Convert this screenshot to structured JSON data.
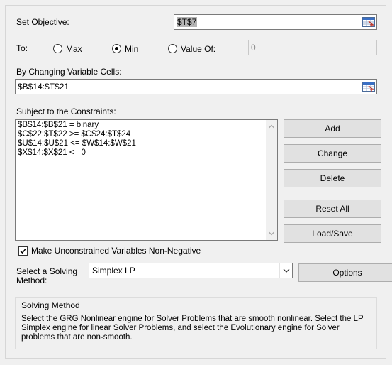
{
  "objective": {
    "label": "Set Objective:",
    "value": "$T$7"
  },
  "to": {
    "label": "To:",
    "options": [
      {
        "label": "Max",
        "checked": false
      },
      {
        "label": "Min",
        "checked": true
      },
      {
        "label": "Value Of:",
        "checked": false
      }
    ],
    "value_of": "0"
  },
  "changing_cells": {
    "label": "By Changing Variable Cells:",
    "value": "$B$14:$T$21"
  },
  "constraints": {
    "label": "Subject to the Constraints:",
    "items": [
      "$B$14:$B$21 = binary",
      "$C$22:$T$22 >= $C$24:$T$24",
      "$U$14:$U$21 <= $W$14:$W$21",
      "$X$14:$X$21 <= 0"
    ]
  },
  "buttons": {
    "add": "Add",
    "change": "Change",
    "delete": "Delete",
    "reset_all": "Reset All",
    "load_save": "Load/Save",
    "options": "Options"
  },
  "nonneg": {
    "label": "Make Unconstrained Variables Non-Negative",
    "checked": true
  },
  "method": {
    "label_line1": "Select a Solving",
    "label_line2": "Method:",
    "value": "Simplex LP"
  },
  "solving_method": {
    "title": "Solving Method",
    "description": "Select the GRG Nonlinear engine for Solver Problems that are smooth nonlinear. Select the LP Simplex engine for linear Solver Problems, and select the Evolutionary engine for Solver problems that are non-smooth."
  },
  "icons": [
    "cell-reference-icon",
    "scroll-up-icon",
    "scroll-down-icon",
    "checkmark-icon",
    "dropdown-arrow-icon"
  ]
}
